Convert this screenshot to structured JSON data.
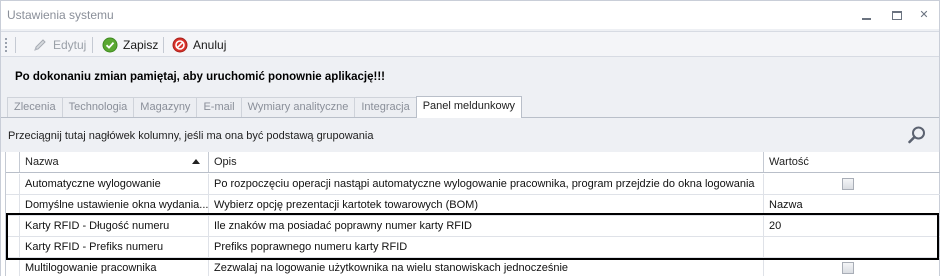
{
  "window": {
    "title": "Ustawienia systemu"
  },
  "toolbar": {
    "edit_label": "Edytuj",
    "save_label": "Zapisz",
    "cancel_label": "Anuluj"
  },
  "notice": "Po dokonaniu zmian pamiętaj, aby uruchomić  ponownie aplikację!!!",
  "tabs": [
    {
      "label": "Zlecenia"
    },
    {
      "label": "Technologia"
    },
    {
      "label": "Magazyny"
    },
    {
      "label": "E-mail"
    },
    {
      "label": "Wymiary analityczne"
    },
    {
      "label": "Integracja"
    },
    {
      "label": "Panel meldunkowy",
      "active": true
    }
  ],
  "grid": {
    "group_hint": "Przeciągnij tutaj nagłówek kolumny, jeśli ma ona być podstawą grupowania",
    "columns": {
      "name": "Nazwa",
      "desc": "Opis",
      "value": "Wartość"
    },
    "sort": "ascending",
    "rows": [
      {
        "name": "Automatyczne wylogowanie",
        "desc": "Po rozpoczęciu operacji nastąpi automatyczne wylogowanie pracownika, program przejdzie do okna logowania",
        "value": "",
        "checkbox": true,
        "checked": false
      },
      {
        "name": "Domyślne ustawienie okna wydania...",
        "desc": "Wybierz opcję prezentacji kartotek towarowych (BOM)",
        "value": "Nazwa",
        "checkbox": false
      },
      {
        "name": "Karty RFID - Długość numeru",
        "desc": "Ile znaków ma posiadać poprawny numer karty RFID",
        "value": "20",
        "checkbox": false
      },
      {
        "name": "Karty RFID - Prefiks numeru",
        "desc": "Prefiks poprawnego numeru karty RFID",
        "value": "",
        "checkbox": false
      },
      {
        "name": "Multilogowanie pracownika",
        "desc": "Zezwalaj na logowanie użytkownika na wielu stanowiskach jednocześnie",
        "value": "",
        "checkbox": true,
        "checked": false
      }
    ]
  },
  "colors": {
    "highlight_border": "#000000",
    "save_icon": "#5aa832",
    "cancel_icon": "#d9322b"
  }
}
